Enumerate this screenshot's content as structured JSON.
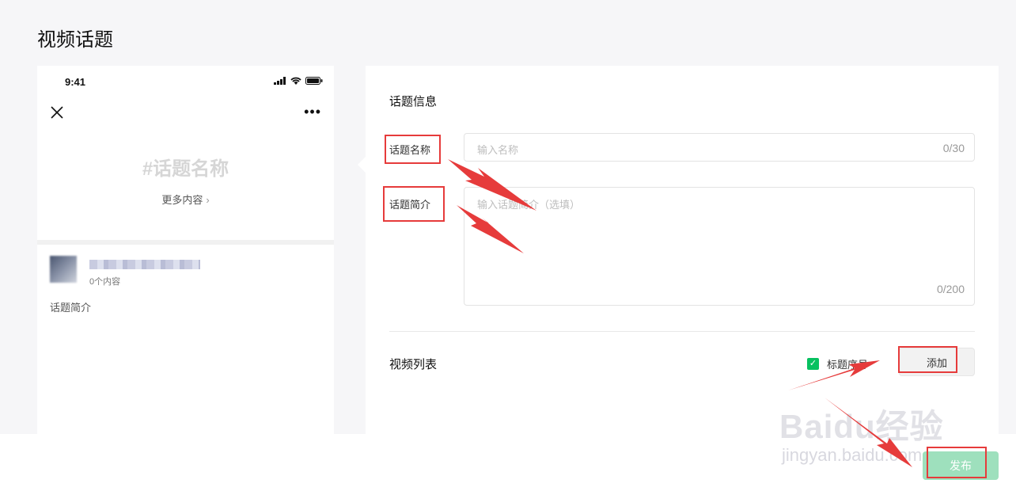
{
  "page": {
    "title": "视频话题"
  },
  "preview": {
    "status_time": "9:41",
    "topic_name": "#话题名称",
    "more_link": "更多内容",
    "creator_count": "0个内容",
    "intro": "话题简介"
  },
  "form": {
    "section_title": "话题信息",
    "name_label": "话题名称",
    "name_placeholder": "输入名称",
    "name_count": "0/30",
    "intro_label": "话题简介",
    "intro_placeholder": "输入话题简介（选填）",
    "intro_count": "0/200",
    "list_title": "视频列表",
    "order_label": "标题序号",
    "add_label": "添加"
  },
  "footer": {
    "publish_label": "发布"
  },
  "watermark": {
    "brand": "Baidu经验",
    "url": "jingyan.baidu.com"
  },
  "colors": {
    "accent": "#07c160",
    "publish_disabled": "#9ee0bd",
    "annotation": "#e63b3b"
  },
  "icons": {
    "close": "close-icon",
    "more": "more-icon",
    "chevron": "chevron-right-icon",
    "check": "check-icon"
  }
}
